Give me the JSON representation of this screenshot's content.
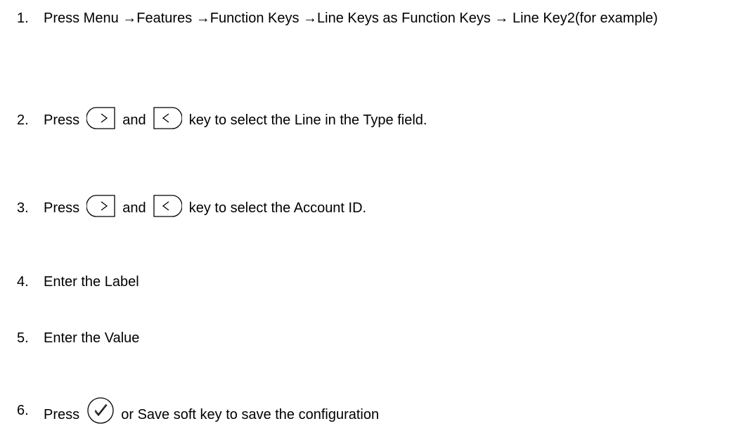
{
  "steps": [
    {
      "num": "1.",
      "text": "Press Menu →Features →Function Keys →Line Keys as Function Keys → Line Key2(for example)"
    },
    {
      "num": "2.",
      "pre": "Press",
      "mid": "and",
      "post": "key to select the Line in the Type field.",
      "icons": [
        "right-arrow-key-icon",
        "left-arrow-key-icon"
      ]
    },
    {
      "num": "3.",
      "pre": "Press",
      "mid": "and",
      "post": "key to select the Account ID.",
      "icons": [
        "right-arrow-key-icon",
        "left-arrow-key-icon"
      ]
    },
    {
      "num": "4.",
      "text": "Enter the Label"
    },
    {
      "num": "5.",
      "text": "Enter the Value"
    },
    {
      "num": "6.",
      "pre": "Press",
      "post": "or Save soft key to save the configuration",
      "icons": [
        "ok-checkmark-key-icon"
      ]
    }
  ]
}
